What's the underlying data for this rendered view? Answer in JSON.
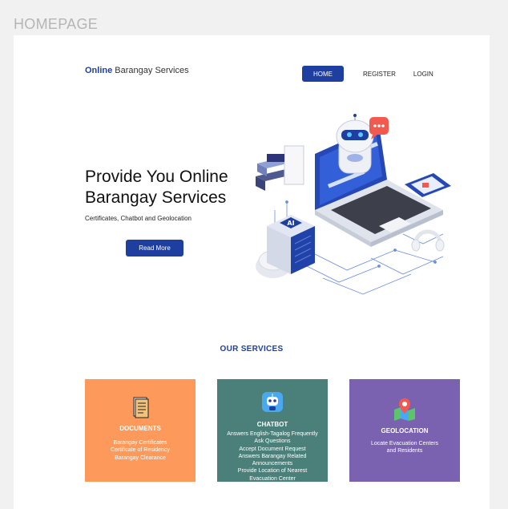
{
  "frame_label": "HOMEPAGE",
  "brand": {
    "bold": "Online",
    "rest": "Barangay Services"
  },
  "nav": [
    {
      "label": "HOME",
      "active": true
    },
    {
      "label": "REGISTER",
      "active": false
    },
    {
      "label": "LOGIN",
      "active": false
    }
  ],
  "hero": {
    "title_line1": "Provide You Online",
    "title_line2": "Barangay Services",
    "subtitle": "Certificates, Chatbot and Geolocation",
    "button": "Read More",
    "chip_text": "AI"
  },
  "services": {
    "title": "OUR SERVICES",
    "cards": [
      {
        "title": "DOCUMENTS",
        "icon": "document-icon",
        "color": "#fd9a5b",
        "lines": [
          "Barangay Certificates",
          "Certificate of Residency",
          "Barangay Clearance"
        ]
      },
      {
        "title": "CHATBOT",
        "icon": "robot-icon",
        "color": "#4a8079",
        "lines": [
          "Answers English-Tagalog Frequently",
          "Ask Questions",
          "Accept Document Request",
          "Answers Barangay Related",
          "Announcements",
          "Provide Location of Nearest",
          "Evacuation Center"
        ]
      },
      {
        "title": "GEOLOCATION",
        "icon": "map-pin-icon",
        "color": "#7a62b1",
        "lines": [
          "Locate Evacuation Centers",
          "and Residents"
        ]
      }
    ]
  },
  "colors": {
    "primary": "#1e3fa0",
    "frame_bg": "#f1f1f1",
    "page_bg": "#ffffff"
  }
}
